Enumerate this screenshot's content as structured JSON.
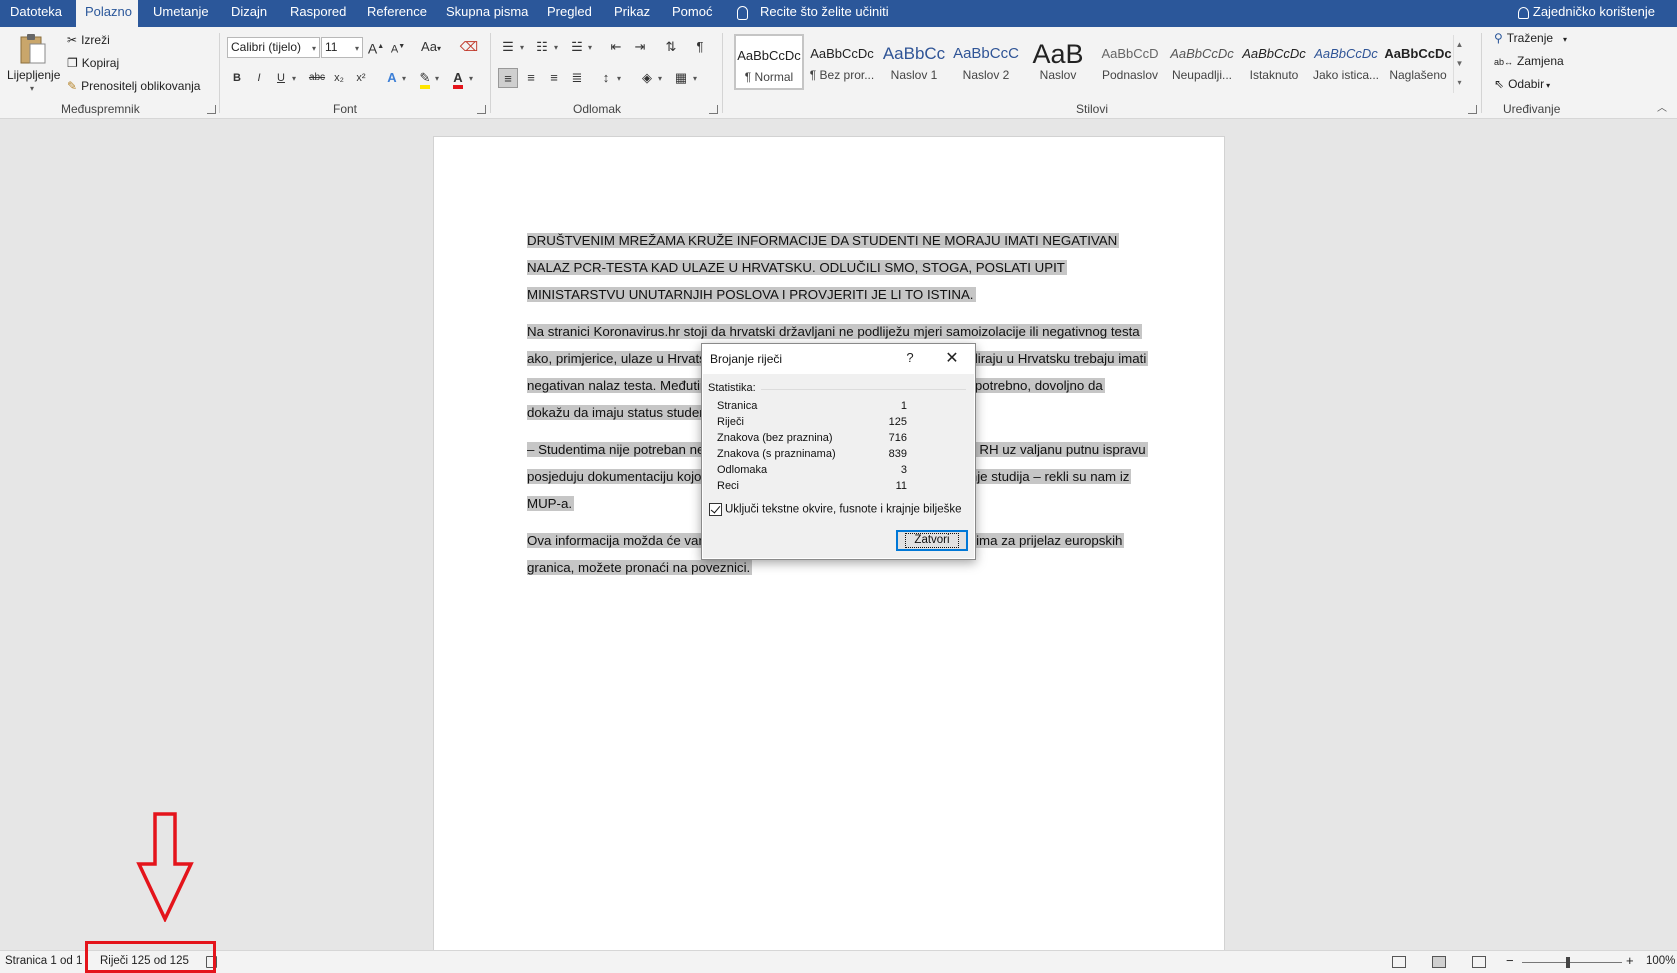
{
  "tabs": [
    {
      "label": "Datoteka",
      "active": false
    },
    {
      "label": "Polazno",
      "active": true
    },
    {
      "label": "Umetanje",
      "active": false
    },
    {
      "label": "Dizajn",
      "active": false
    },
    {
      "label": "Raspored",
      "active": false
    },
    {
      "label": "Reference",
      "active": false
    },
    {
      "label": "Skupna pisma",
      "active": false
    },
    {
      "label": "Pregled",
      "active": false
    },
    {
      "label": "Prikaz",
      "active": false
    },
    {
      "label": "Pomoć",
      "active": false
    }
  ],
  "tell_me": "Recite što želite učiniti",
  "share": "Zajedničko korištenje",
  "clipboard": {
    "paste": "Lijepljenje",
    "cut": "Izreži",
    "copy": "Kopiraj",
    "format_painter": "Prenositelj oblikovanja",
    "group_label": "Međuspremnik"
  },
  "font": {
    "family": "Calibri (tijelo)",
    "size": "11",
    "group_label": "Font",
    "bold": "B",
    "italic": "I",
    "underline": "U",
    "strike": "abc",
    "subscript": "x₂",
    "superscript": "x²",
    "change_case": "Aa",
    "grow": "A",
    "shrink": "A"
  },
  "paragraph": {
    "group_label": "Odlomak"
  },
  "styles": {
    "group_label": "Stilovi",
    "items": [
      {
        "sample": "AaBbCcDc",
        "name": "¶ Normal",
        "selected": true
      },
      {
        "sample": "AaBbCcDc",
        "name": "¶ Bez pror...",
        "selected": false
      },
      {
        "sample": "AaBbCc",
        "name": "Naslov 1",
        "selected": false
      },
      {
        "sample": "AaBbCcC",
        "name": "Naslov 2",
        "selected": false
      },
      {
        "sample": "AaB",
        "name": "Naslov",
        "selected": false
      },
      {
        "sample": "AaBbCcD",
        "name": "Podnaslov",
        "selected": false
      },
      {
        "sample": "AaBbCcDc",
        "name": "Neupadlji...",
        "selected": false
      },
      {
        "sample": "AaBbCcDc",
        "name": "Istaknuto",
        "selected": false
      },
      {
        "sample": "AaBbCcDc",
        "name": "Jako istica...",
        "selected": false
      },
      {
        "sample": "AaBbCcDc",
        "name": "Naglašeno",
        "selected": false
      }
    ]
  },
  "editing": {
    "group_label": "Uređivanje",
    "find": "Traženje",
    "replace": "Zamjena",
    "select": "Odabir"
  },
  "document": {
    "paragraphs": [
      "DRUŠTVENIM MREŽAMA KRUŽE INFORMACIJE DA STUDENTI NE MORAJU IMATI NEGATIVAN NALAZ PCR-TESTA KAD ULAZE U HRVATSKU. ODLUČILI SMO, STOGA, POSLATI UPIT MINISTARSTVU UNUTARNJIH POSLOVA I PROVJERITI JE LI TO ISTINA.",
      "Na stranici Koronavirus.hr stoji da hrvatski državljani ne podliježu mjeri samoizolacije ili negativnog testa ako, primjerice, ulaze u Hrvatsku iz zemalja EU-a, no strani studenti koji studiraju u Hrvatsku trebaju imati negativan nalaz testa. Međutim, studentima koji dolaze iz zemalja EU-a nije potrebno, dovoljno da dokažu da imaju status studenta:",
      "– Studentima nije potreban negativan nalaz PCR-testa ako prilikom ulaska u RH uz valjanu putnu ispravu posjeduju dokumentaciju kojom dokazuju status studenta, odnosno pohađanje studija – rekli su nam iz MUP-a.",
      "Ova informacija možda će vam pomoći ako putujete. Više informacija o uvjetima za prijelaz europskih granica, možete pronaći na poveznici."
    ]
  },
  "dialog": {
    "title": "Brojanje riječi",
    "help": "?",
    "statistics_label": "Statistika:",
    "rows": [
      {
        "label": "Stranica",
        "value": "1"
      },
      {
        "label": "Riječi",
        "value": "125"
      },
      {
        "label": "Znakova (bez praznina)",
        "value": "716"
      },
      {
        "label": "Znakova (s prazninama)",
        "value": "839"
      },
      {
        "label": "Odlomaka",
        "value": "3"
      },
      {
        "label": "Reci",
        "value": "11"
      }
    ],
    "include_checkbox": "Uključi tekstne okvire, fusnote i krajnje bilješke",
    "include_checked": true,
    "close_button": "Zatvori"
  },
  "statusbar": {
    "page": "Stranica 1 od 1",
    "words": "Riječi 125 od 125",
    "zoom": "100%"
  },
  "colors": {
    "ribbon_blue": "#2b579a",
    "annotation_red": "#e4141b",
    "selection_gray": "#c6c6c6"
  }
}
